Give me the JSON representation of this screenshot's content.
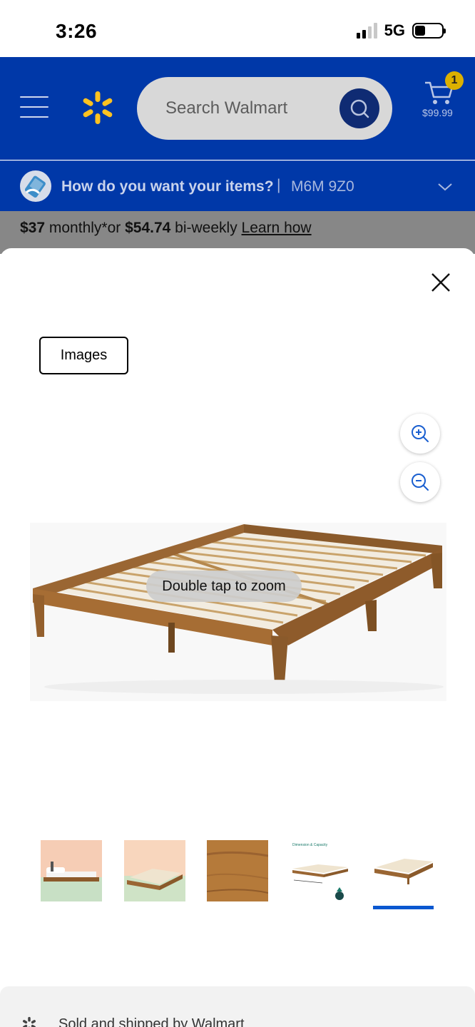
{
  "status_bar": {
    "time": "3:26",
    "network": "5G",
    "signal_bars": 2
  },
  "header": {
    "search_placeholder": "Search Walmart",
    "cart_count": "1",
    "cart_total": "$99.99",
    "brand_color": "#0038a8",
    "spark_color": "#ffc220"
  },
  "fulfillment": {
    "title": "How do you want your items?",
    "separator": "|",
    "postal_code": "M6M 9Z0"
  },
  "financing": {
    "monthly_amount": "$37",
    "monthly_suffix": " monthly*or ",
    "biweekly_amount": "$54.74",
    "biweekly_suffix": " bi-weekly ",
    "link": "Learn how"
  },
  "viewer": {
    "tab_label": "Images",
    "zoom_hint": "Double tap to zoom",
    "thumbnails": [
      {
        "name": "bed-room-scene",
        "selected": false
      },
      {
        "name": "bed-frame-green-floor",
        "selected": false
      },
      {
        "name": "wood-texture",
        "selected": false
      },
      {
        "name": "dimension-capacity",
        "label": "Dimension & Capacity",
        "selected": false
      },
      {
        "name": "bed-frame-white-bg",
        "selected": true
      }
    ]
  },
  "seller": {
    "text": "Sold and shipped by Walmart"
  }
}
